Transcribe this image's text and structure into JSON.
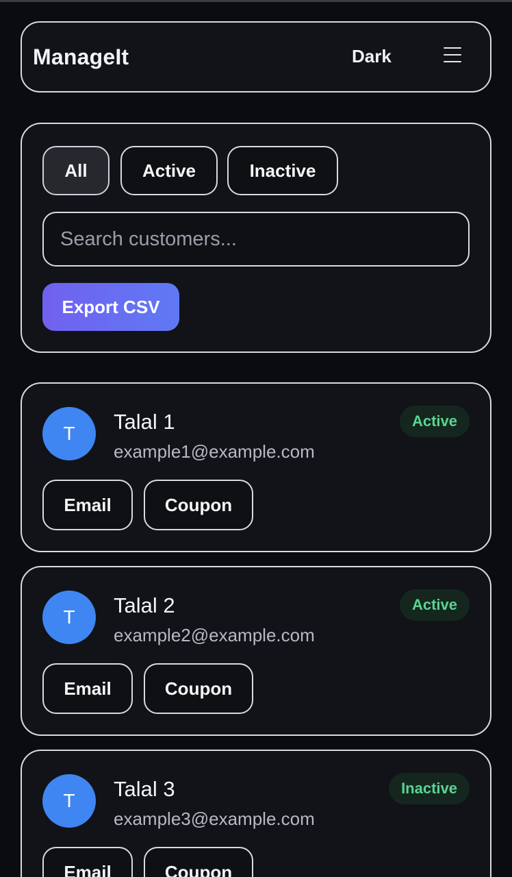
{
  "header": {
    "brand": "ManageIt",
    "theme_label": "Dark"
  },
  "filters": {
    "chips": [
      "All",
      "Active",
      "Inactive"
    ],
    "selected": "All",
    "search_placeholder": "Search customers...",
    "export_label": "Export CSV"
  },
  "customers": [
    {
      "initial": "T",
      "name": "Talal 1",
      "email": "example1@example.com",
      "status": "Active",
      "email_label": "Email",
      "coupon_label": "Coupon"
    },
    {
      "initial": "T",
      "name": "Talal 2",
      "email": "example2@example.com",
      "status": "Active",
      "email_label": "Email",
      "coupon_label": "Coupon"
    },
    {
      "initial": "T",
      "name": "Talal 3",
      "email": "example3@example.com",
      "status": "Inactive",
      "email_label": "Email",
      "coupon_label": "Coupon"
    }
  ],
  "colors": {
    "avatar": "#3f86f2",
    "badge_text": "#59d48f",
    "badge_bg": "#15261f",
    "export_gradient_start": "#7161ef",
    "export_gradient_end": "#5f79f5"
  }
}
